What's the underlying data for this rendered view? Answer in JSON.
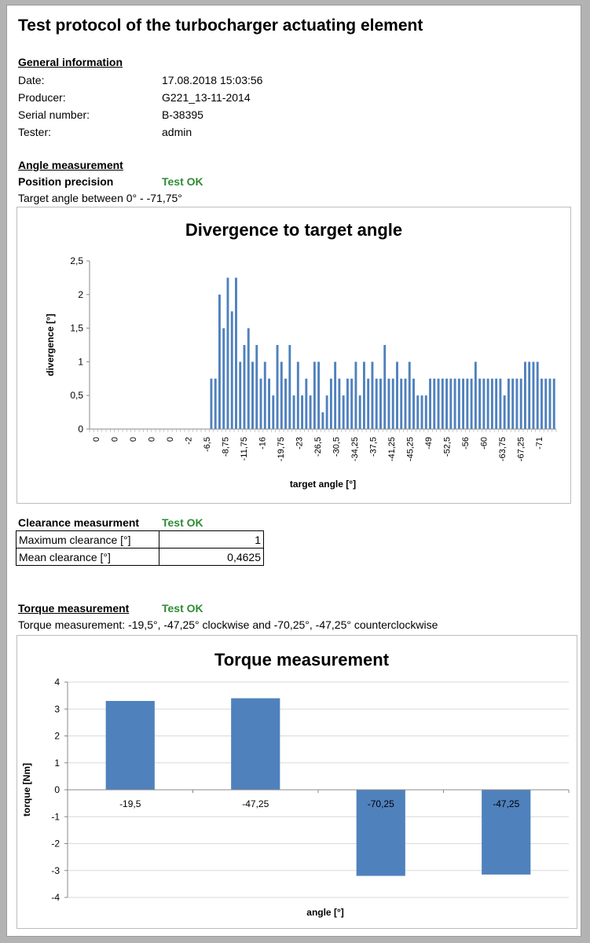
{
  "title": "Test protocol of the turbocharger actuating element",
  "general": {
    "heading": "General information",
    "rows": [
      {
        "label": "Date:",
        "value": "17.08.2018 15:03:56"
      },
      {
        "label": "Producer:",
        "value": "G221_13-11-2014"
      },
      {
        "label": "Serial number:",
        "value": "B-38395"
      },
      {
        "label": "Tester:",
        "value": "admin"
      }
    ]
  },
  "angle": {
    "heading": "Angle measurement",
    "precision_label": "Position precision",
    "precision_status": "Test OK",
    "target_text": "Target angle between 0° - -71,75°"
  },
  "clearance": {
    "heading": "Clearance measurment",
    "status": "Test OK",
    "rows": [
      {
        "label": "Maximum clearance [°]",
        "value": "1"
      },
      {
        "label": "Mean clearance [°]",
        "value": "0,4625"
      }
    ]
  },
  "torque": {
    "heading": "Torque measurement",
    "status": "Test OK",
    "description": "Torque measurement: -19,5°, -47,25° clockwise and -70,25°, -47,25° counterclockwise"
  },
  "colors": {
    "bar": "#4f81bd",
    "ok": "#2e8b34",
    "grid": "#d9d9d9"
  },
  "chart_data": [
    {
      "type": "bar",
      "title": "Divergence to target angle",
      "xlabel": "target angle [°]",
      "ylabel": "divergence [°]",
      "ylim": [
        0,
        2.5
      ],
      "yticks": [
        "0",
        "0,5",
        "1",
        "1,5",
        "2",
        "2,5"
      ],
      "grid": false,
      "tick_labels": [
        "0",
        "0",
        "0",
        "0",
        "0",
        "-2",
        "-6,5",
        "-8,75",
        "-11,75",
        "-16",
        "-19,75",
        "-23",
        "-26,5",
        "-30,5",
        "-34,25",
        "-37,5",
        "-41,25",
        "-45,25",
        "-49",
        "-52,5",
        "-56",
        "-60",
        "-63,75",
        "-67,25",
        "-71"
      ],
      "values": [
        0,
        0,
        0,
        0,
        0,
        0,
        0,
        0,
        0,
        0,
        0,
        0,
        0,
        0,
        0,
        0,
        0,
        0,
        0,
        0,
        0,
        0,
        0,
        0,
        0,
        0,
        0,
        0,
        0,
        0.75,
        0.75,
        2.0,
        1.5,
        2.25,
        1.75,
        2.25,
        1.0,
        1.25,
        1.5,
        1.0,
        1.25,
        0.75,
        1.0,
        0.75,
        0.5,
        1.25,
        1.0,
        0.75,
        1.25,
        0.5,
        1.0,
        0.5,
        0.75,
        0.5,
        1.0,
        1.0,
        0.25,
        0.5,
        0.75,
        1.0,
        0.75,
        0.5,
        0.75,
        0.75,
        1.0,
        0.5,
        1.0,
        0.75,
        1.0,
        0.75,
        0.75,
        1.25,
        0.75,
        0.75,
        1.0,
        0.75,
        0.75,
        1.0,
        0.75,
        0.5,
        0.5,
        0.5,
        0.75,
        0.75,
        0.75,
        0.75,
        0.75,
        0.75,
        0.75,
        0.75,
        0.75,
        0.75,
        0.75,
        1.0,
        0.75,
        0.75,
        0.75,
        0.75,
        0.75,
        0.75,
        0.5,
        0.75,
        0.75,
        0.75,
        0.75,
        1.0,
        1.0,
        1.0,
        1.0,
        0.75,
        0.75,
        0.75,
        0.75
      ]
    },
    {
      "type": "bar",
      "title": "Torque measurement",
      "xlabel": "angle [°]",
      "ylabel": "torque [Nm]",
      "ylim": [
        -4,
        4
      ],
      "yticks": [
        "-4",
        "-3",
        "-2",
        "-1",
        "0",
        "1",
        "2",
        "3",
        "4"
      ],
      "grid": true,
      "categories": [
        "-19,5",
        "-47,25",
        "-70,25",
        "-47,25"
      ],
      "values": [
        3.3,
        3.4,
        -3.2,
        -3.15
      ]
    }
  ]
}
